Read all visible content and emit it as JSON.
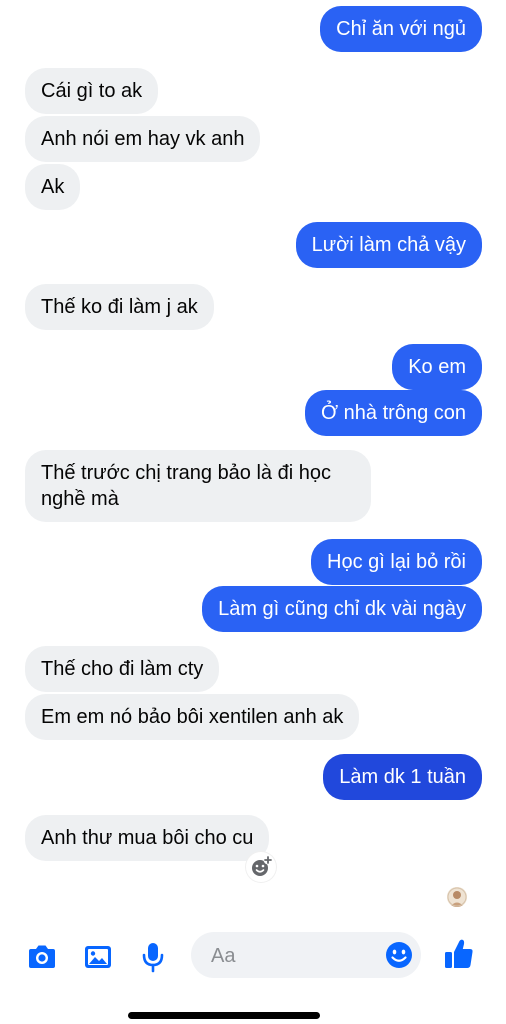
{
  "messages": [
    {
      "side": "out",
      "text": "Chỉ ăn với ngủ"
    },
    {
      "side": "in",
      "text": "Cái gì to ak"
    },
    {
      "side": "in",
      "text": "Anh nói em hay vk anh"
    },
    {
      "side": "in",
      "text": "Ak"
    },
    {
      "side": "out",
      "text": "Lười làm chả vậy"
    },
    {
      "side": "in",
      "text": "Thế ko đi làm j ak"
    },
    {
      "side": "out",
      "text": "Ko em"
    },
    {
      "side": "out",
      "text": "Ở nhà trông con"
    },
    {
      "side": "in",
      "text": "Thế trước chị trang bảo là đi học nghề mà"
    },
    {
      "side": "out",
      "text": "Học gì lại bỏ rồi"
    },
    {
      "side": "out",
      "text": "Làm gì cũng chỉ dk vài ngày"
    },
    {
      "side": "in",
      "text": "Thế cho đi làm cty"
    },
    {
      "side": "in",
      "text": "Em em nó bảo bôi xentilen anh ak"
    },
    {
      "side": "out",
      "text": "Làm dk 1 tuần"
    },
    {
      "side": "in",
      "text": "Anh thư mua bôi cho cu"
    }
  ],
  "composer": {
    "placeholder": "Aa",
    "icons": [
      "camera-icon",
      "image-icon",
      "microphone-icon",
      "emoji-icon",
      "thumbs-up-icon"
    ]
  },
  "colors": {
    "outgoing": "#2a62f4",
    "incoming": "#eef0f2",
    "accent": "#0866ff"
  }
}
